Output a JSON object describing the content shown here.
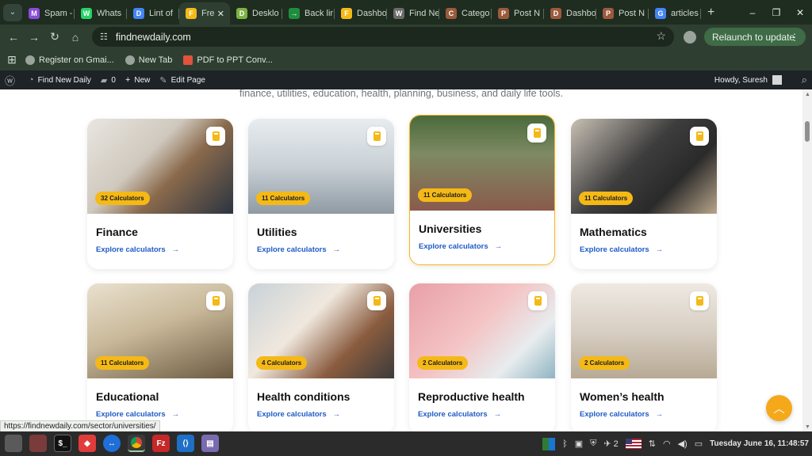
{
  "browser": {
    "tabs": [
      {
        "title": "Spam -",
        "fav_color": "#8a4dd8",
        "fav_glyph": "M"
      },
      {
        "title": "Whats",
        "fav_color": "#25d366",
        "fav_glyph": "W"
      },
      {
        "title": "Lint of",
        "fav_color": "#4285f4",
        "fav_glyph": "D"
      },
      {
        "title": "Fre",
        "fav_color": "#f5b916",
        "fav_glyph": "F",
        "active": true
      },
      {
        "title": "Desklo",
        "fav_color": "#7cb342",
        "fav_glyph": "D"
      },
      {
        "title": "Back lir",
        "fav_color": "#1e8e3e",
        "fav_glyph": "→"
      },
      {
        "title": "Dashbo",
        "fav_color": "#f5b916",
        "fav_glyph": "F"
      },
      {
        "title": "Find Ne",
        "fav_color": "#6b6b6b",
        "fav_glyph": "W"
      },
      {
        "title": "Catego",
        "fav_color": "#9c5a3c",
        "fav_glyph": "C"
      },
      {
        "title": "Post N",
        "fav_color": "#9c5a3c",
        "fav_glyph": "P"
      },
      {
        "title": "Dashbo",
        "fav_color": "#9c5a3c",
        "fav_glyph": "D"
      },
      {
        "title": "Post N",
        "fav_color": "#9c5a3c",
        "fav_glyph": "P"
      },
      {
        "title": "articles",
        "fav_color": "#4285f4",
        "fav_glyph": "G"
      }
    ],
    "url": "findnewdaily.com",
    "relaunch_label": "Relaunch to update",
    "bookmarks": [
      {
        "label": "Register on Gmai...",
        "color": "#9aa39c"
      },
      {
        "label": "New Tab",
        "color": "#9aa39c"
      },
      {
        "label": "PDF to PPT Conv...",
        "color": "#e0533d"
      }
    ]
  },
  "wp_admin": {
    "site_name": "Find New Daily",
    "comments_count": "0",
    "new_label": "New",
    "edit_label": "Edit Page",
    "howdy": "Howdy, Suresh"
  },
  "page": {
    "intro_text": "finance, utilities, education, health, planning, business, and daily life tools.",
    "explore_label": "Explore calculators",
    "arrow": "→",
    "sectors": [
      {
        "name": "Finance",
        "badge": "32 Calculators"
      },
      {
        "name": "Utilities",
        "badge": "11 Calculators"
      },
      {
        "name": "Universities",
        "badge": "11 Calculators",
        "highlight": true
      },
      {
        "name": "Mathematics",
        "badge": "11 Calculators"
      },
      {
        "name": "Educational",
        "badge": "11 Calculators"
      },
      {
        "name": "Health conditions",
        "badge": "4 Calculators"
      },
      {
        "name": "Reproductive health",
        "badge": "2 Calculators"
      },
      {
        "name": "Women’s health",
        "badge": "2 Calculators"
      }
    ]
  },
  "status_url": "https://findnewdaily.com/sector/universities/",
  "taskbar": {
    "notif_count": "2",
    "clock": "Tuesday June 16, 11:48:57"
  },
  "colors": {
    "accent": "#f5b916",
    "link": "#1e5bc6"
  }
}
